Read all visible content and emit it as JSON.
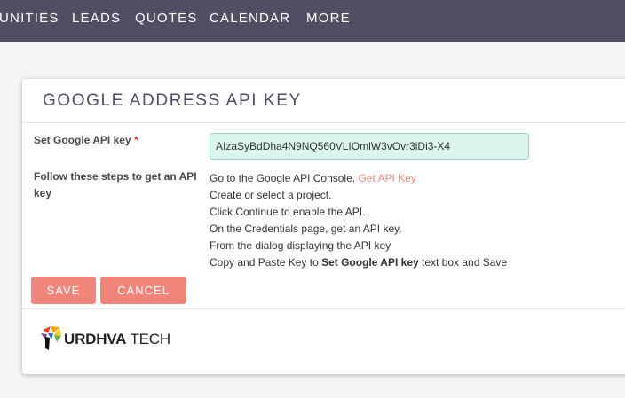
{
  "nav": {
    "items": [
      "UNITIES",
      "LEADS",
      "QUOTES",
      "CALENDAR",
      "MORE"
    ]
  },
  "panel": {
    "title": "GOOGLE ADDRESS API KEY",
    "api_key_label": "Set Google API key",
    "required_mark": "*",
    "api_key_value": "AIzaSyBdDha4N9NQ560VLIOmlW3vOvr3iDi3-X4",
    "steps_label": "Follow these steps to get an API key",
    "steps": {
      "line1_text": "Go to the Google API Console. ",
      "line1_link": "Get API Key",
      "line2": "Create or select a project.",
      "line3": "Click Continue to enable the API.",
      "line4": "On the Credentials page, get an API key.",
      "line5": "From the dialog displaying the API key",
      "line6_pre": "Copy and Paste Key to ",
      "line6_bold": "Set Google API key",
      "line6_post": " text box and Save"
    },
    "save_label": "SAVE",
    "cancel_label": "CANCEL"
  },
  "logo": {
    "bold_text": "URDHVA",
    "light_text": " TECH"
  },
  "colors": {
    "nav_bg": "#534d64",
    "button_bg": "#f0857c",
    "input_bg": "#d9f5ee",
    "link": "#f0857c",
    "required": "#e0333b"
  }
}
